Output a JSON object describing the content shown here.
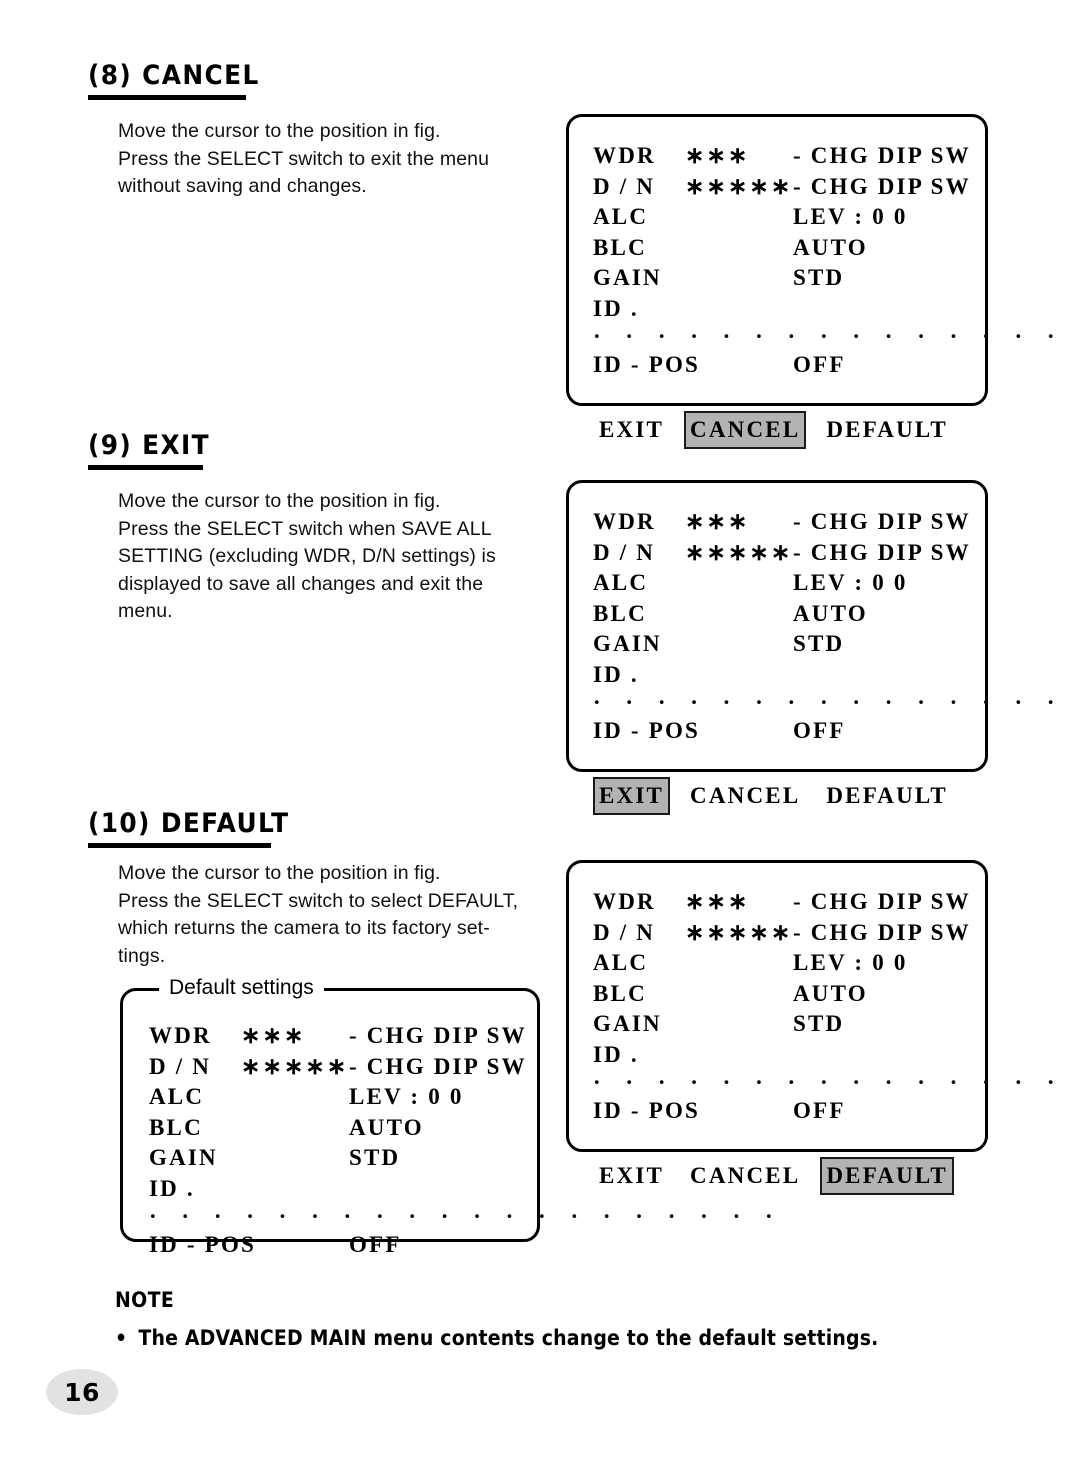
{
  "page": {
    "number": "16"
  },
  "sections": [
    {
      "heading": "(8) CANCEL",
      "body": [
        "Move the cursor to the position in fig.",
        "Press the SELECT switch to exit the menu",
        "without saving and changes."
      ]
    },
    {
      "heading": "(9) EXIT",
      "body": [
        "Move the cursor to the position in fig.",
        "Press the SELECT switch when SAVE ALL",
        "SETTING (excluding WDR, D/N settings) is",
        "displayed to save all changes and exit the",
        "menu."
      ]
    },
    {
      "heading": "(10) DEFAULT",
      "body": [
        "Move the cursor to the position in fig.",
        "Press the SELECT switch to select DEFAULT,",
        "which returns the camera to its factory set-",
        "tings."
      ]
    }
  ],
  "osd": {
    "rows": [
      {
        "label": "WDR",
        "mid": "∗∗∗",
        "val": "- CHG  DIP  SW"
      },
      {
        "label": "D / N",
        "mid": "∗∗∗∗∗",
        "val": "- CHG  DIP  SW"
      },
      {
        "label": "ALC",
        "mid": "",
        "val": "LEV :   0 0"
      },
      {
        "label": "BLC",
        "mid": "",
        "val": "AUTO"
      },
      {
        "label": "GAIN",
        "mid": "",
        "val": "STD"
      },
      {
        "label": "ID .",
        "mid": "",
        "val": ""
      }
    ],
    "dots": "· · · · · · · · · · · · · · · · · · · ·",
    "id_pos": {
      "label": "ID - POS",
      "val": "OFF"
    },
    "actions": {
      "exit": "EXIT",
      "cancel": "CANCEL",
      "default": "DEFAULT"
    },
    "default_settings_legend": "Default  settings",
    "highlight_color": "#b3b3b3"
  },
  "note": {
    "title": "NOTE",
    "bullet": "•",
    "item": "The ADVANCED MAIN menu contents change to the default settings."
  }
}
